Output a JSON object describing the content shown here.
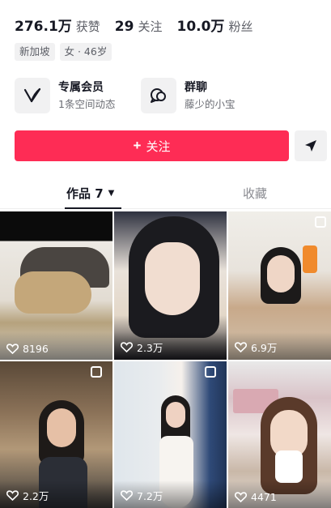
{
  "stats": [
    {
      "value": "276.1万",
      "label": "获赞"
    },
    {
      "value": "29",
      "label": "关注"
    },
    {
      "value": "10.0万",
      "label": "粉丝"
    }
  ],
  "tags": [
    "新加坡",
    "女 · 46岁"
  ],
  "features": {
    "member": {
      "title": "专属会员",
      "subtitle": "1条空间动态",
      "icon": "v-membership-icon"
    },
    "group": {
      "title": "群聊",
      "subtitle": "藤少的小宝",
      "icon": "group-chat-icon"
    }
  },
  "actions": {
    "follow_label": "关注",
    "follow_icon": "plus-icon",
    "share_icon": "send-icon"
  },
  "tabs": {
    "works": "作品 7",
    "likes": "收藏"
  },
  "colors": {
    "accent": "#fe2c55",
    "text": "#161823",
    "muted": "#5c5e66",
    "chip_bg": "#f1f1f2"
  },
  "videos": [
    {
      "likes": "8196"
    },
    {
      "likes": "2.3万"
    },
    {
      "likes": "6.9万"
    },
    {
      "likes": "2.2万"
    },
    {
      "likes": "7.2万"
    },
    {
      "likes": "4471"
    }
  ]
}
